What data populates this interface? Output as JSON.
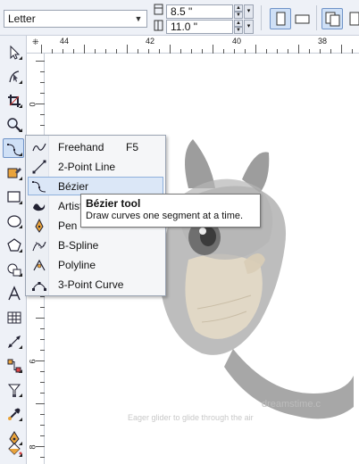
{
  "property_bar": {
    "page_size": "Letter",
    "width_value": "8.5 \"",
    "height_value": "11.0 \"",
    "width_icon": "page-width-icon",
    "height_icon": "page-height-icon",
    "orientation_selected": "portrait",
    "buttons": [
      "portrait-icon",
      "landscape-icon",
      "all-pages-icon"
    ]
  },
  "ruler": {
    "top_labels": [
      "44",
      "42",
      "40",
      "38"
    ],
    "left_labels": [
      "0",
      "2",
      "4",
      "6",
      "8"
    ]
  },
  "toolbox": {
    "tools": [
      {
        "name": "pick-tool",
        "icon": "arrow-pointer-icon"
      },
      {
        "name": "shape-tool",
        "icon": "shape-edit-icon"
      },
      {
        "name": "crop-tool",
        "icon": "crop-icon"
      },
      {
        "name": "zoom-tool",
        "icon": "magnifier-icon"
      },
      {
        "name": "curve-tool",
        "icon": "curve-icon"
      },
      {
        "name": "smart-fill-tool",
        "icon": "smart-fill-icon"
      },
      {
        "name": "rectangle-tool",
        "icon": "rectangle-icon"
      },
      {
        "name": "ellipse-tool",
        "icon": "ellipse-icon"
      },
      {
        "name": "polygon-tool",
        "icon": "polygon-icon"
      },
      {
        "name": "basic-shapes-tool",
        "icon": "basic-shapes-icon"
      },
      {
        "name": "text-tool",
        "icon": "text-icon"
      },
      {
        "name": "table-tool",
        "icon": "table-icon"
      },
      {
        "name": "dimension-tool",
        "icon": "dimension-icon"
      },
      {
        "name": "connector-tool",
        "icon": "connector-icon"
      },
      {
        "name": "interactive-tool",
        "icon": "blend-icon"
      },
      {
        "name": "eyedropper-tool",
        "icon": "eyedropper-icon"
      },
      {
        "name": "outline-tool",
        "icon": "pen-nib-icon"
      },
      {
        "name": "fill-tool",
        "icon": "paint-bucket-icon"
      }
    ],
    "active": "curve-tool"
  },
  "curve_menu": {
    "items": [
      {
        "label": "Freehand",
        "shortcut": "F5",
        "icon": "freehand-icon"
      },
      {
        "label": "2-Point Line",
        "shortcut": "",
        "icon": "two-point-line-icon"
      },
      {
        "label": "Bézier",
        "shortcut": "",
        "icon": "bezier-icon"
      },
      {
        "label": "Artistic Media",
        "shortcut": "",
        "icon": "artistic-media-icon"
      },
      {
        "label": "Pen",
        "shortcut": "",
        "icon": "pen-icon"
      },
      {
        "label": "B-Spline",
        "shortcut": "",
        "icon": "b-spline-icon"
      },
      {
        "label": "Polyline",
        "shortcut": "",
        "icon": "polyline-icon"
      },
      {
        "label": "3-Point Curve",
        "shortcut": "",
        "icon": "three-point-curve-icon"
      }
    ],
    "highlighted": "Bézier"
  },
  "tooltip": {
    "title": "Bézier tool",
    "description": "Draw curves one segment at a time."
  },
  "canvas": {
    "watermark_caption": "Eager glider to glide through the air",
    "watermark_brand": "dreamstime.c"
  },
  "colors": {
    "accent": "#6f93c8",
    "highlight": "#cfe0f6",
    "toolbar_bg": "#eef1f7"
  }
}
